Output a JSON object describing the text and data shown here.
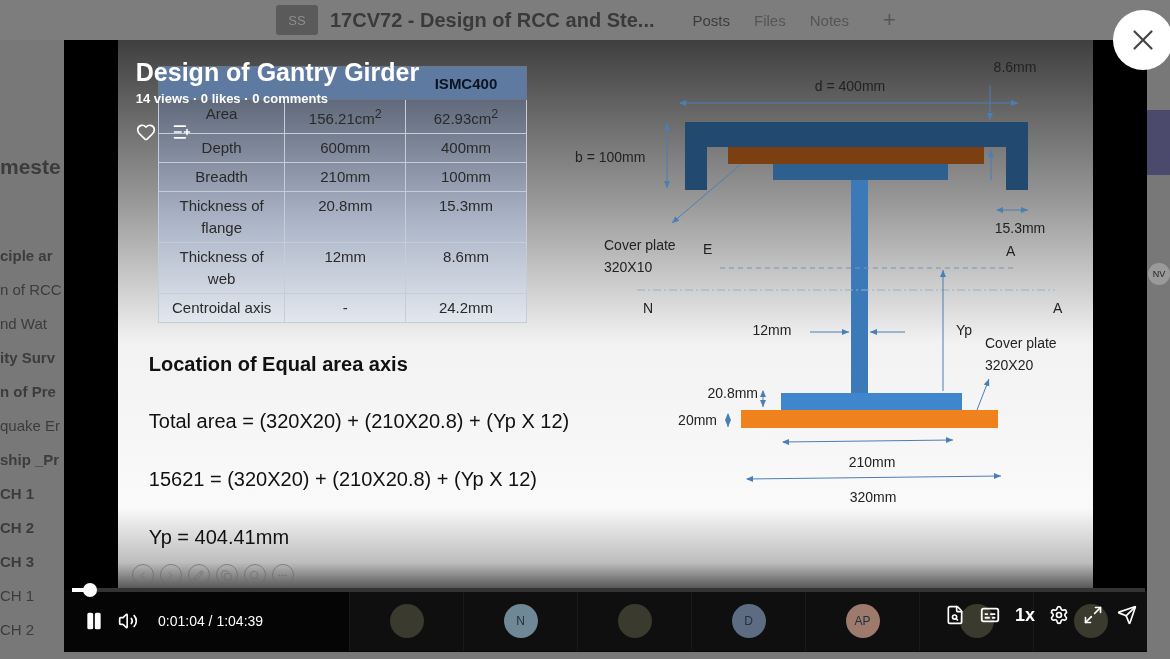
{
  "background_page": {
    "badge": "SS",
    "title": "17CV72 - Design of RCC and Ste...",
    "tabs": [
      {
        "label": "Posts",
        "selected": true
      },
      {
        "label": "Files",
        "selected": false
      },
      {
        "label": "Notes",
        "selected": false
      }
    ],
    "add_tab": "+",
    "sidebar_items": [
      {
        "label": "meste",
        "kind": "heading"
      },
      {
        "label": "ciple ar",
        "kind": "bold"
      },
      {
        "label": "n of RCC",
        "kind": "normal"
      },
      {
        "label": "nd Wat",
        "kind": "normal"
      },
      {
        "label": "ity Surv",
        "kind": "bold"
      },
      {
        "label": "n of Pre",
        "kind": "bold"
      },
      {
        "label": "quake Er",
        "kind": "normal"
      },
      {
        "label": "ship _Pr",
        "kind": "bold"
      },
      {
        "label": "CH 1",
        "kind": "bold"
      },
      {
        "label": "CH 2",
        "kind": "bold"
      },
      {
        "label": "CH 3",
        "kind": "bold"
      },
      {
        "label": "CH 1",
        "kind": "normal"
      },
      {
        "label": "CH 2",
        "kind": "normal"
      }
    ],
    "right_avatar": "NV"
  },
  "video": {
    "title": "Design of Gantry Girder",
    "meta": "14 views · 0 likes · 0 comments",
    "liked": false
  },
  "slide": {
    "table": {
      "columns": [
        {},
        {},
        {
          "label": "ISMC400"
        }
      ],
      "rows": [
        [
          "Area",
          "156.21cm$^{2}$",
          "62.93cm$^{2}$"
        ],
        [
          "Depth",
          "600mm",
          "400mm"
        ],
        [
          "Breadth",
          "210mm",
          "100mm"
        ],
        [
          "Thickness of flange",
          "20.8mm",
          "15.3mm"
        ],
        [
          "Thickness of web",
          "12mm",
          "8.6mm"
        ],
        [
          "Centroidal axis",
          "-",
          "24.2mm"
        ]
      ]
    },
    "heading": "Location of Equal area axis",
    "lines": [
      "Total area = (320X20) + (210X20.8) + (Yp X 12)",
      "15621 = (320X20) + (210X20.8) + (Yp X 12)",
      "Yp = 404.41mm"
    ],
    "diagram": {
      "web_thickness_top": "8.6mm",
      "top_width": "d = 400mm",
      "breadth": "b = 100mm",
      "flange_thickness": "15.3mm",
      "top_plate": [
        "Cover plate",
        "320X10"
      ],
      "label_e": "E",
      "label_a_top": "A",
      "label_n": "N",
      "label_a": "A",
      "web_thickness": "12mm",
      "yp": "Yp",
      "bottom_plate": [
        "Cover plate",
        "320X20"
      ],
      "flange_bottom": "20.8mm",
      "plate_thickness": "20mm",
      "flange_width": "210mm",
      "plate_width": "320mm"
    }
  },
  "player": {
    "progress": {
      "level": 0.0165
    },
    "playing": true,
    "time": "0:01:04 / 1:04:39",
    "speed": "1x",
    "participants": [
      {
        "kind": "photo"
      },
      {
        "kind": "initials",
        "initials": "N",
        "color": "#6f8896"
      },
      {
        "kind": "photo"
      },
      {
        "kind": "initials",
        "initials": "D",
        "color": "#5d6c82"
      },
      {
        "kind": "initials",
        "initials": "AP",
        "color": "#9d7a6c"
      },
      {
        "kind": "photo"
      },
      {
        "kind": "photo"
      }
    ]
  }
}
